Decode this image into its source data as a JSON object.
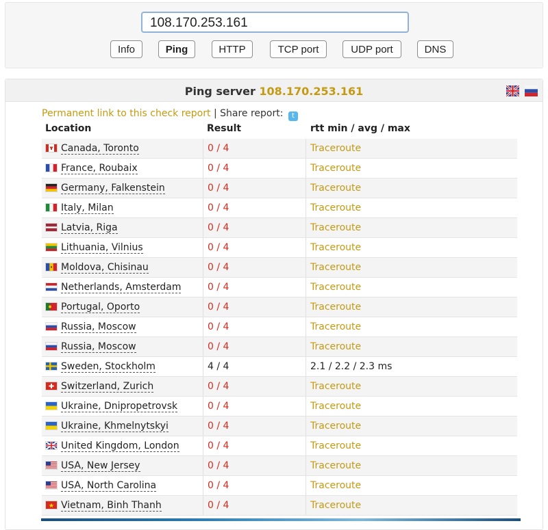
{
  "search": {
    "value": "108.170.253.161"
  },
  "tabs": [
    {
      "label": "Info",
      "active": false
    },
    {
      "label": "Ping",
      "active": true
    },
    {
      "label": "HTTP",
      "active": false
    },
    {
      "label": "TCP port",
      "active": false
    },
    {
      "label": "UDP port",
      "active": false
    },
    {
      "label": "DNS",
      "active": false
    }
  ],
  "panel": {
    "title_prefix": "Ping server",
    "title_ip": "108.170.253.161",
    "languages": [
      "uk-flag-icon",
      "ru-flag-icon"
    ]
  },
  "share": {
    "permanent_link": "Permanent link to this check report",
    "separator": " | ",
    "share_label": "Share report:",
    "share_icon": "twitter-icon"
  },
  "table": {
    "headers": [
      "Location",
      "Result",
      "rtt min / avg / max"
    ],
    "rows": [
      {
        "flag": "ca",
        "location": "Canada, Toronto",
        "result": "0 / 4",
        "ok": false,
        "rtt": "Traceroute"
      },
      {
        "flag": "fr",
        "location": "France, Roubaix",
        "result": "0 / 4",
        "ok": false,
        "rtt": "Traceroute"
      },
      {
        "flag": "de",
        "location": "Germany, Falkenstein",
        "result": "0 / 4",
        "ok": false,
        "rtt": "Traceroute"
      },
      {
        "flag": "it",
        "location": "Italy, Milan",
        "result": "0 / 4",
        "ok": false,
        "rtt": "Traceroute"
      },
      {
        "flag": "lv",
        "location": "Latvia, Riga",
        "result": "0 / 4",
        "ok": false,
        "rtt": "Traceroute"
      },
      {
        "flag": "lt",
        "location": "Lithuania, Vilnius",
        "result": "0 / 4",
        "ok": false,
        "rtt": "Traceroute"
      },
      {
        "flag": "md",
        "location": "Moldova, Chisinau",
        "result": "0 / 4",
        "ok": false,
        "rtt": "Traceroute"
      },
      {
        "flag": "nl",
        "location": "Netherlands, Amsterdam",
        "result": "0 / 4",
        "ok": false,
        "rtt": "Traceroute"
      },
      {
        "flag": "pt",
        "location": "Portugal, Oporto",
        "result": "0 / 4",
        "ok": false,
        "rtt": "Traceroute"
      },
      {
        "flag": "ru",
        "location": "Russia, Moscow",
        "result": "0 / 4",
        "ok": false,
        "rtt": "Traceroute"
      },
      {
        "flag": "ru",
        "location": "Russia, Moscow",
        "result": "0 / 4",
        "ok": false,
        "rtt": "Traceroute"
      },
      {
        "flag": "se",
        "location": "Sweden, Stockholm",
        "result": "4 / 4",
        "ok": true,
        "rtt": "2.1 / 2.2 / 2.3 ms"
      },
      {
        "flag": "ch",
        "location": "Switzerland, Zurich",
        "result": "0 / 4",
        "ok": false,
        "rtt": "Traceroute"
      },
      {
        "flag": "ua",
        "location": "Ukraine, Dnipropetrovsk",
        "result": "0 / 4",
        "ok": false,
        "rtt": "Traceroute"
      },
      {
        "flag": "ua",
        "location": "Ukraine, Khmelnytskyi",
        "result": "0 / 4",
        "ok": false,
        "rtt": "Traceroute"
      },
      {
        "flag": "gb",
        "location": "United Kingdom, London",
        "result": "0 / 4",
        "ok": false,
        "rtt": "Traceroute"
      },
      {
        "flag": "us",
        "location": "USA, New Jersey",
        "result": "0 / 4",
        "ok": false,
        "rtt": "Traceroute"
      },
      {
        "flag": "us",
        "location": "USA, North Carolina",
        "result": "0 / 4",
        "ok": false,
        "rtt": "Traceroute"
      },
      {
        "flag": "vn",
        "location": "Vietnam, Binh Thanh",
        "result": "0 / 4",
        "ok": false,
        "rtt": "Traceroute"
      }
    ]
  },
  "colors": {
    "accent": "#c49a12",
    "fail": "#d42b1e",
    "input_border": "#8fb2da"
  }
}
